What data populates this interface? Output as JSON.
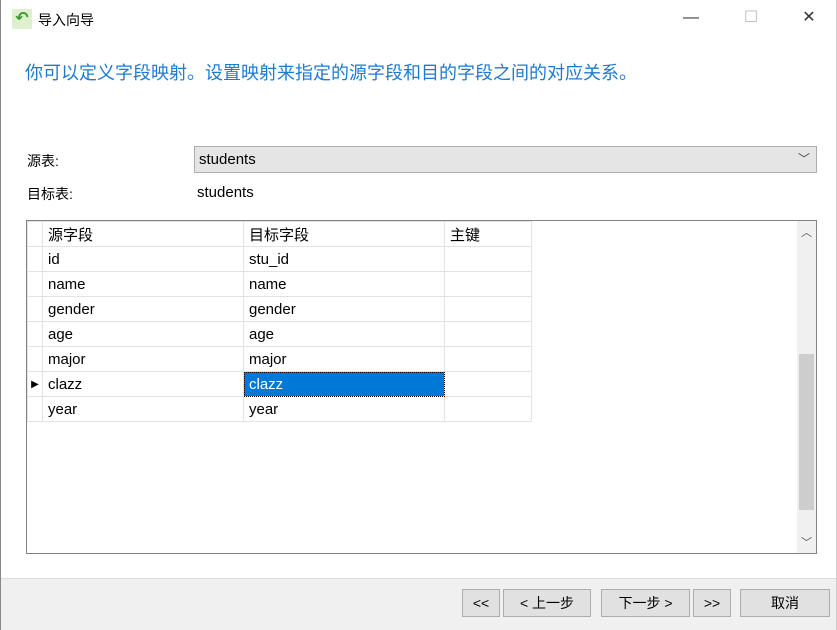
{
  "window": {
    "title": "导入向导",
    "minimize": "—",
    "maximize": "☐",
    "close": "✕"
  },
  "description": "你可以定义字段映射。设置映射来指定的源字段和目的字段之间的对应关系。",
  "source_table": {
    "label": "源表:",
    "value": "students"
  },
  "target_table": {
    "label": "目标表:",
    "value": "students"
  },
  "grid": {
    "headers": [
      "源字段",
      "目标字段",
      "主键"
    ],
    "rows": [
      {
        "source": "id",
        "target": "stu_id",
        "pk": ""
      },
      {
        "source": "name",
        "target": "name",
        "pk": ""
      },
      {
        "source": "gender",
        "target": "gender",
        "pk": ""
      },
      {
        "source": "age",
        "target": "age",
        "pk": ""
      },
      {
        "source": "major",
        "target": "major",
        "pk": ""
      },
      {
        "source": "clazz",
        "target": "clazz",
        "pk": "",
        "current": true
      },
      {
        "source": "year",
        "target": "year",
        "pk": ""
      }
    ]
  },
  "buttons": {
    "first": "<<",
    "prev": "< 上一步",
    "next": "下一步 >",
    "last": ">>",
    "cancel": "取消"
  }
}
